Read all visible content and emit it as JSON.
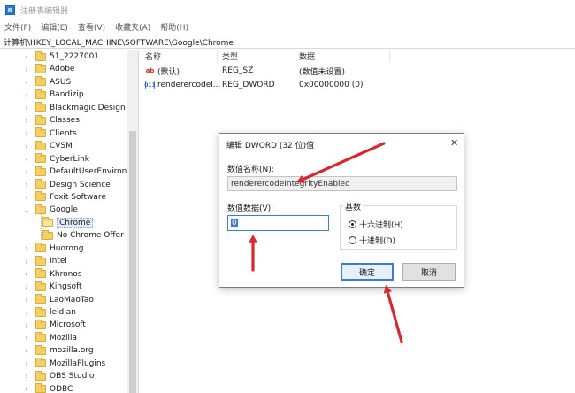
{
  "window": {
    "title": "注册表编辑器"
  },
  "menu": [
    "文件(F)",
    "编辑(E)",
    "查看(V)",
    "收藏夹(A)",
    "帮助(H)"
  ],
  "address": "计算机\\HKEY_LOCAL_MACHINE\\SOFTWARE\\Google\\Chrome",
  "tree": [
    {
      "label": "51_2227001",
      "state": "collapsed"
    },
    {
      "label": "Adobe",
      "state": "collapsed"
    },
    {
      "label": "ASUS",
      "state": "collapsed"
    },
    {
      "label": "Bandizip",
      "state": "collapsed"
    },
    {
      "label": "Blackmagic Design",
      "state": "collapsed"
    },
    {
      "label": "Classes",
      "state": "collapsed"
    },
    {
      "label": "Clients",
      "state": "collapsed"
    },
    {
      "label": "CVSM",
      "state": "collapsed"
    },
    {
      "label": "CyberLink",
      "state": "collapsed"
    },
    {
      "label": "DefaultUserEnvironme",
      "state": "collapsed"
    },
    {
      "label": "Design Science",
      "state": "collapsed"
    },
    {
      "label": "Foxit Software",
      "state": "collapsed"
    },
    {
      "label": "Google",
      "state": "expanded"
    },
    {
      "label": "Chrome",
      "state": "selected"
    },
    {
      "label": "No Chrome Offer U",
      "state": "leaf"
    },
    {
      "label": "Huorong",
      "state": "collapsed"
    },
    {
      "label": "Intel",
      "state": "collapsed"
    },
    {
      "label": "Khronos",
      "state": "collapsed"
    },
    {
      "label": "Kingsoft",
      "state": "collapsed"
    },
    {
      "label": "LaoMaoTao",
      "state": "collapsed"
    },
    {
      "label": "leidian",
      "state": "collapsed"
    },
    {
      "label": "Microsoft",
      "state": "collapsed"
    },
    {
      "label": "Mozilla",
      "state": "collapsed"
    },
    {
      "label": "mozilla.org",
      "state": "collapsed"
    },
    {
      "label": "MozillaPlugins",
      "state": "collapsed"
    },
    {
      "label": "OBS Studio",
      "state": "collapsed"
    },
    {
      "label": "ODBC",
      "state": "collapsed"
    }
  ],
  "list": {
    "headers": {
      "name": "名称",
      "type": "类型",
      "data": "数据"
    },
    "rows": [
      {
        "icon": "string-value-icon",
        "icon_text": "ab",
        "name": "(默认)",
        "type": "REG_SZ",
        "data": "(数值未设置)"
      },
      {
        "icon": "dword-value-icon",
        "icon_text": "011",
        "name": "renderercodel...",
        "type": "REG_DWORD",
        "data": "0x00000000 (0)"
      }
    ]
  },
  "dialog": {
    "title": "编辑 DWORD (32 位)值",
    "close": "✕",
    "name_label": "数值名称(N):",
    "name_value": "renderercodeIntegrityEnabled",
    "data_label": "数值数据(V):",
    "data_value": "0",
    "base_label": "基数",
    "base_options": [
      {
        "label": "十六进制(H)",
        "checked": true
      },
      {
        "label": "十进制(D)",
        "checked": false
      }
    ],
    "ok_label": "确定",
    "cancel_label": "取消"
  },
  "colors": {
    "annotation_arrow": "#d7282f",
    "accent": "#3a7bd5"
  }
}
